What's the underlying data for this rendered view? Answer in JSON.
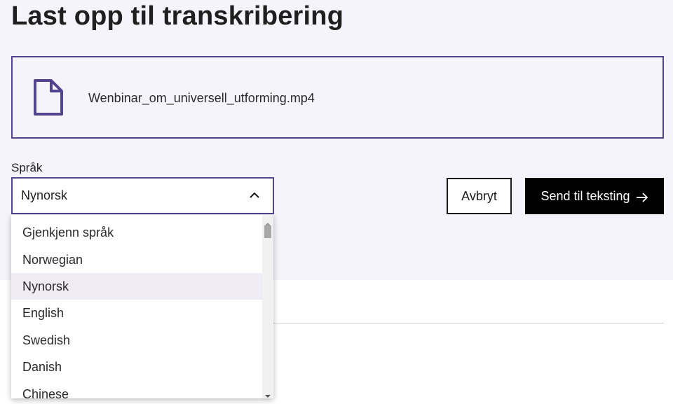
{
  "page": {
    "title": "Last opp til transkribering"
  },
  "file": {
    "icon": "file-icon",
    "name": "Wenbinar_om_universell_utforming.mp4"
  },
  "language": {
    "label": "Språk",
    "selected": "Nynorsk",
    "open": true,
    "options": [
      "Gjenkjenn språk",
      "Norwegian",
      "Nynorsk",
      "English",
      "Swedish",
      "Danish",
      "Chinese"
    ]
  },
  "actions": {
    "cancel_label": "Avbryt",
    "send_label": "Send til teksting"
  },
  "colors": {
    "accent": "#52458e",
    "panel_background": "#f6f4fb",
    "primary_button": "#000000",
    "selected_option": "#efedf3"
  }
}
